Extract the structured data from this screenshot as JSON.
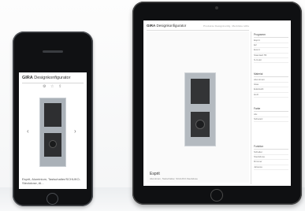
{
  "brand": {
    "logo": "GIRA",
    "app_name": "Designkonfigurator"
  },
  "phone": {
    "caption": "Esprit, Aluminium, Tastschalter/SCHUKO-Steckdose, Al..."
  },
  "tablet": {
    "nav": "Produkte  Designkonfig.  Merkliste  Hilfe",
    "product_title": "Esprit",
    "product_desc": "Aluminium, Tastschalter, SCHUKO-Steckdose",
    "sidebar": [
      {
        "title": "Programm",
        "items": [
          "Esprit",
          "E2",
          "Event",
          "Standard 55",
          "S-Color"
        ]
      },
      {
        "title": "Material",
        "items": [
          "Aluminium",
          "Glas",
          "Edelstahl",
          "Holz"
        ]
      },
      {
        "title": "Farbe",
        "items": [
          "Alu",
          "Schwarz"
        ]
      },
      {
        "title": "Funktion",
        "items": [
          "Schalter",
          "Steckdose",
          "Dimmer",
          "Jalousie"
        ]
      }
    ]
  }
}
